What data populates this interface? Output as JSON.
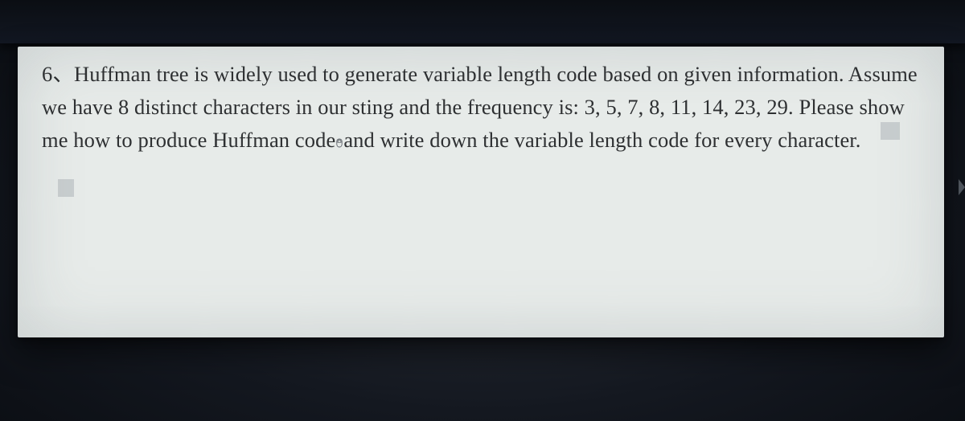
{
  "question": {
    "number": "6、",
    "line1a": "Huffman tree is widely used to generate variable length code based on given information. Assume",
    "line2": "we have 8 distinct characters in our sting and the frequency is: 3, 5, 7, 8, 11, 14, 23, 29. Please show",
    "line3a": "me how to produce Huffman code",
    "line3b": "and write down the variable length code for every character."
  }
}
